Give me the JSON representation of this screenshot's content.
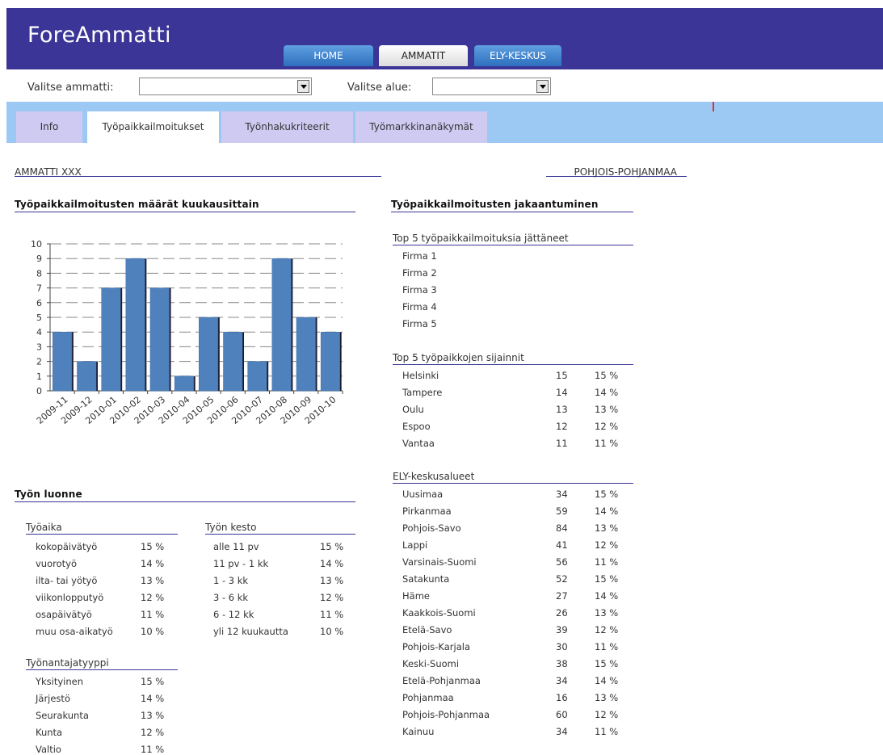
{
  "app": {
    "title": "ForeAmmatti"
  },
  "nav": {
    "home": "HOME",
    "ammatit": "AMMATIT",
    "ely": "ELY-KESKUS"
  },
  "selectors": {
    "ammatti_label": "Valitse ammatti:",
    "ammatti_value": "",
    "alue_label": "Valitse alue:",
    "alue_value": ""
  },
  "tabs": [
    "Info",
    "Työpaikkailmoitukset",
    "Työnhakukriteerit",
    "Työmarkkinanäkymät"
  ],
  "context": {
    "ammatti": "AMMATTI XXX",
    "alue": "POHJOIS-POHJANMAA"
  },
  "chart_section_title": "Työpaikkailmoitusten määrät kuukausittain",
  "chart_data": {
    "type": "bar",
    "categories": [
      "2009-11",
      "2009-12",
      "2010-01",
      "2010-02",
      "2010-03",
      "2010-04",
      "2010-05",
      "2010-06",
      "2010-07",
      "2010-08",
      "2010-09",
      "2010-10"
    ],
    "values": [
      4,
      2,
      7,
      9,
      7,
      1,
      5,
      4,
      2,
      9,
      5,
      4
    ],
    "ylim": [
      0,
      10
    ],
    "yticks": [
      "0",
      "1",
      "2",
      "3",
      "4",
      "5",
      "6",
      "7",
      "8",
      "9",
      "10"
    ],
    "grid": true,
    "bar_color": "#4f81bd"
  },
  "luonne": {
    "title": "Työn luonne",
    "tyoaika": {
      "title": "Työaika",
      "rows": [
        {
          "label": "kokopäivätyö",
          "pct": "15 %"
        },
        {
          "label": "vuorotyö",
          "pct": "14 %"
        },
        {
          "label": "ilta- tai yötyö",
          "pct": "13 %"
        },
        {
          "label": "viikonlopputyö",
          "pct": "12 %"
        },
        {
          "label": "osapäivätyö",
          "pct": "11 %"
        },
        {
          "label": "muu osa-aikatyö",
          "pct": "10 %"
        }
      ]
    },
    "kesto": {
      "title": "Työn kesto",
      "rows": [
        {
          "label": "alle 11 pv",
          "pct": "15 %"
        },
        {
          "label": "11 pv - 1 kk",
          "pct": "14 %"
        },
        {
          "label": "1 - 3 kk",
          "pct": "13 %"
        },
        {
          "label": "3 - 6 kk",
          "pct": "12 %"
        },
        {
          "label": "6 - 12 kk",
          "pct": "11 %"
        },
        {
          "label": "yli 12 kuukautta",
          "pct": "10 %"
        }
      ]
    },
    "tyonantaja": {
      "title": "Työnantajatyyppi",
      "rows": [
        {
          "label": "Yksityinen",
          "pct": "15 %"
        },
        {
          "label": "Järjestö",
          "pct": "14 %"
        },
        {
          "label": "Seurakunta",
          "pct": "13 %"
        },
        {
          "label": "Kunta",
          "pct": "12 %"
        },
        {
          "label": "Valtio",
          "pct": "11 %"
        }
      ]
    }
  },
  "jakautuminen": {
    "title": "Työpaikkailmoitusten jakaantuminen",
    "top_firms": {
      "title": "Top 5 työpaikkailmoituksia jättäneet",
      "items": [
        "Firma 1",
        "Firma 2",
        "Firma 3",
        "Firma 4",
        "Firma 5"
      ]
    },
    "top_locations": {
      "title": "Top 5 työpaikkojen sijainnit",
      "rows": [
        {
          "label": "Helsinki",
          "count": "15",
          "pct": "15 %"
        },
        {
          "label": "Tampere",
          "count": "14",
          "pct": "14 %"
        },
        {
          "label": "Oulu",
          "count": "13",
          "pct": "13 %"
        },
        {
          "label": "Espoo",
          "count": "12",
          "pct": "12 %"
        },
        {
          "label": "Vantaa",
          "count": "11",
          "pct": "11 %"
        }
      ]
    },
    "ely": {
      "title": "ELY-keskusalueet",
      "rows": [
        {
          "label": "Uusimaa",
          "count": "34",
          "pct": "15 %"
        },
        {
          "label": "Pirkanmaa",
          "count": "59",
          "pct": "14 %"
        },
        {
          "label": "Pohjois-Savo",
          "count": "84",
          "pct": "13 %"
        },
        {
          "label": "Lappi",
          "count": "41",
          "pct": "12 %"
        },
        {
          "label": "Varsinais-Suomi",
          "count": "56",
          "pct": "11 %"
        },
        {
          "label": "Satakunta",
          "count": "52",
          "pct": "15 %"
        },
        {
          "label": "Häme",
          "count": "27",
          "pct": "14 %"
        },
        {
          "label": "Kaakkois-Suomi",
          "count": "26",
          "pct": "13 %"
        },
        {
          "label": "Etelä-Savo",
          "count": "39",
          "pct": "12 %"
        },
        {
          "label": "Pohjois-Karjala",
          "count": "30",
          "pct": "11 %"
        },
        {
          "label": "Keski-Suomi",
          "count": "38",
          "pct": "15 %"
        },
        {
          "label": "Etelä-Pohjanmaa",
          "count": "34",
          "pct": "14 %"
        },
        {
          "label": "Pohjanmaa",
          "count": "16",
          "pct": "13 %"
        },
        {
          "label": "Pohjois-Pohjanmaa",
          "count": "60",
          "pct": "12 %"
        },
        {
          "label": "Kainuu",
          "count": "34",
          "pct": "11 %"
        }
      ]
    }
  }
}
